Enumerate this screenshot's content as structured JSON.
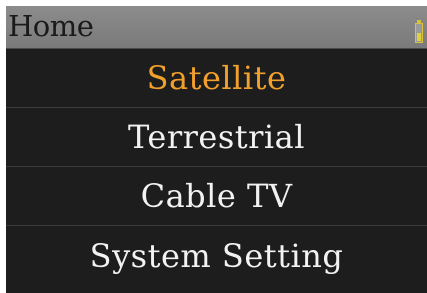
{
  "title_bar": {
    "title": "Home",
    "battery_icon": "battery-icon"
  },
  "menu": {
    "items": [
      {
        "label": "Satellite",
        "selected": true
      },
      {
        "label": "Terrestrial",
        "selected": false
      },
      {
        "label": "Cable  TV",
        "selected": false
      },
      {
        "label": "System  Setting",
        "selected": false
      }
    ]
  },
  "colors": {
    "accent": "#f2a02c",
    "text": "#f2f2f2",
    "background": "#1d1d1d",
    "title_bar": "#828282"
  }
}
